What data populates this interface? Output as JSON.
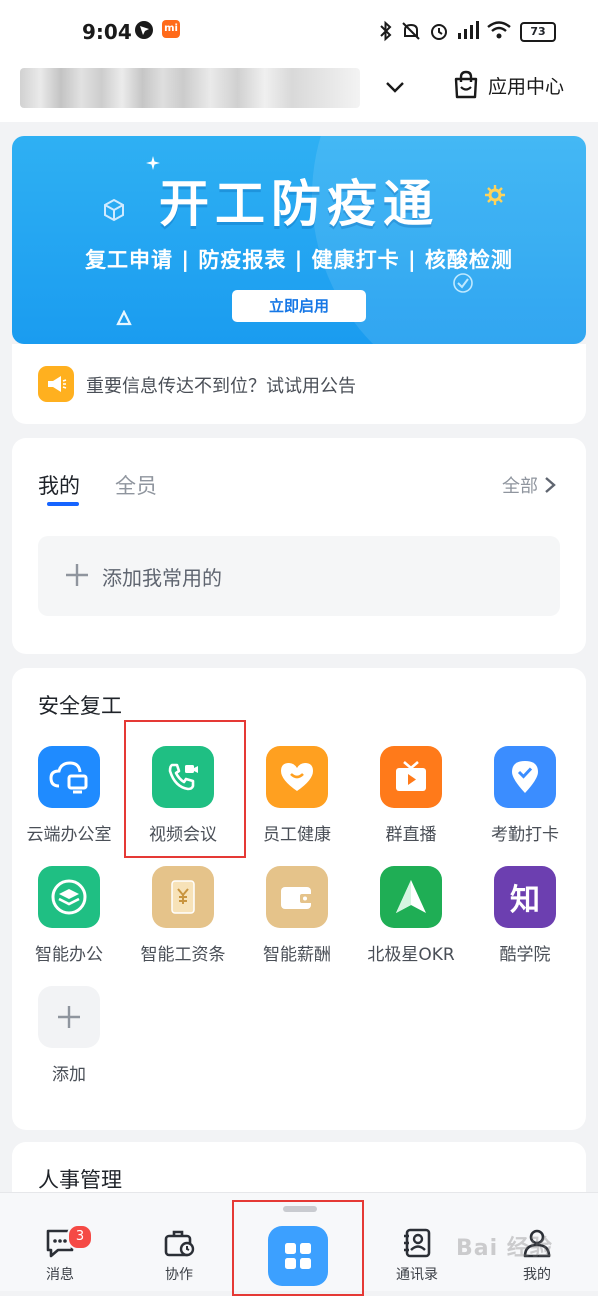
{
  "status_bar": {
    "time": "9:04",
    "battery": "73"
  },
  "header": {
    "app_center_label": "应用中心"
  },
  "banner": {
    "title": "开工防疫通",
    "subtitle": "复工申请 | 防疫报表 | 健康打卡 | 核酸检测",
    "button_label": "立即启用"
  },
  "notice": {
    "text": "重要信息传达不到位？试试用公告"
  },
  "favorites": {
    "tab_mine": "我的",
    "tab_all": "全员",
    "see_all": "全部",
    "add_label": "添加我常用的"
  },
  "safe_return": {
    "title": "安全复工",
    "apps": [
      {
        "label": "云端办公室",
        "icon": "cloud-desktop-icon",
        "color": "#1f8bff"
      },
      {
        "label": "视频会议",
        "icon": "video-call-icon",
        "color": "#1fbf83"
      },
      {
        "label": "员工健康",
        "icon": "heart-smile-icon",
        "color": "#ffa020"
      },
      {
        "label": "群直播",
        "icon": "tv-play-icon",
        "color": "#ff7a1a"
      },
      {
        "label": "考勤打卡",
        "icon": "location-check-icon",
        "color": "#3b8dff"
      },
      {
        "label": "智能办公",
        "icon": "layers-icon",
        "color": "#1fbf83"
      },
      {
        "label": "智能工资条",
        "icon": "salary-slip-icon",
        "color": "#e5c38a"
      },
      {
        "label": "智能薪酬",
        "icon": "wallet-icon",
        "color": "#e5c38a"
      },
      {
        "label": "北极星OKR",
        "icon": "north-star-icon",
        "color": "#1fae55"
      },
      {
        "label": "酷学院",
        "icon": "zhi-icon",
        "color": "#6c3fb0"
      },
      {
        "label": "添加",
        "icon": "plus-icon",
        "color": "#f2f3f5"
      }
    ],
    "zhi_glyph": "知"
  },
  "hr_section": {
    "title": "人事管理"
  },
  "bottom_nav": {
    "messages": "消息",
    "messages_badge": "3",
    "collaboration": "协作",
    "contacts": "通讯录",
    "mine": "我的"
  },
  "watermark": "Bai 经验"
}
